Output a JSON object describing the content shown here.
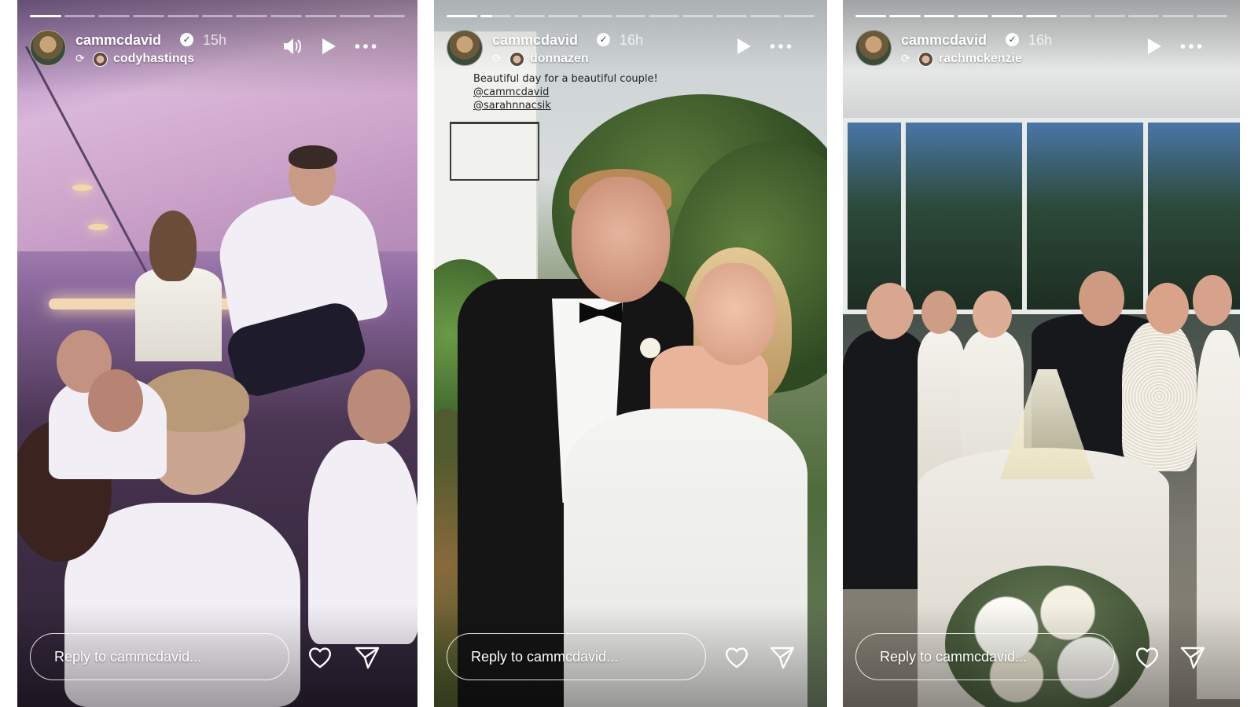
{
  "stories": [
    {
      "username": "cammcdavid",
      "time": "15h",
      "reposted_from": "codyhastinqs",
      "progress_segments": 11,
      "progress_filled": 1,
      "caption": "",
      "reply_placeholder": "Reply to cammcdavid...",
      "controls": [
        "speaker-muted-icon",
        "play-icon",
        "more-icon"
      ]
    },
    {
      "username": "cammcdavid",
      "time": "16h",
      "reposted_from": "donnazen",
      "progress_segments": 11,
      "progress_filled": 1.4,
      "caption": "Beautiful day for a beautiful couple!",
      "mentions": [
        "@cammcdavid",
        "@sarahnnacsik"
      ],
      "reply_placeholder": "Reply to cammcdavid...",
      "controls": [
        "play-icon",
        "more-icon"
      ]
    },
    {
      "username": "cammcdavid",
      "time": "16h",
      "reposted_from": "rachmckenzie",
      "progress_segments": 11,
      "progress_filled": 6,
      "caption": "",
      "reply_placeholder": "Reply to cammcdavid...",
      "controls": [
        "play-icon",
        "more-icon"
      ]
    }
  ],
  "colors": {
    "overlay_text": "#ffffff",
    "caption_text": "#222222",
    "verified_badge": "#ffffff"
  }
}
